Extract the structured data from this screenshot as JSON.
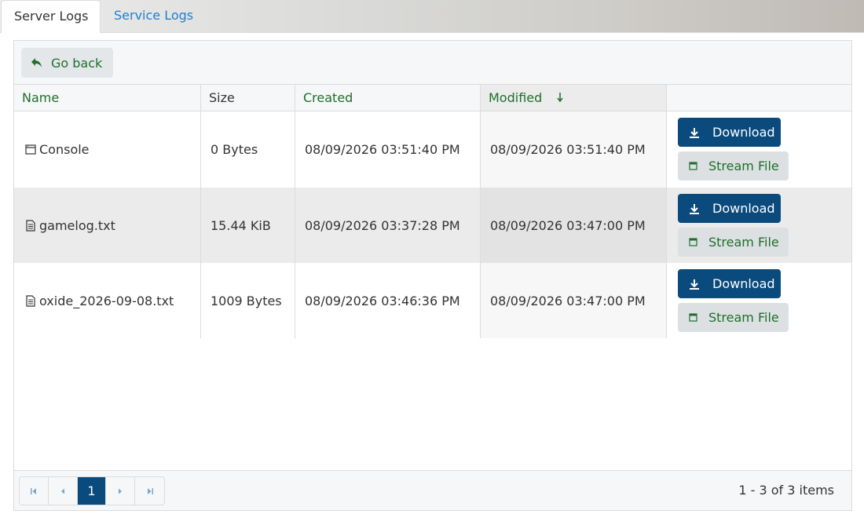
{
  "tabs": [
    {
      "label": "Server Logs",
      "active": true
    },
    {
      "label": "Service Logs",
      "active": false
    }
  ],
  "toolbar": {
    "back_label": "Go back",
    "back_icon": "reply-arrow-icon"
  },
  "columns": [
    {
      "label": "Name"
    },
    {
      "label": "Size"
    },
    {
      "label": "Created"
    },
    {
      "label": "Modified",
      "sort": "descending"
    },
    {
      "label": ""
    }
  ],
  "rows": [
    {
      "icon": "console-window-icon",
      "name": "Console",
      "size": "0 Bytes",
      "created": "08/09/2026 03:51:40 PM",
      "modified": "08/09/2026 03:51:40 PM"
    },
    {
      "icon": "text-file-icon",
      "name": "gamelog.txt",
      "size": "15.44 KiB",
      "created": "08/09/2026 03:37:28 PM",
      "modified": "08/09/2026 03:47:00 PM"
    },
    {
      "icon": "text-file-icon",
      "name": "oxide_2026-09-08.txt",
      "size": "1009 Bytes",
      "created": "08/09/2026 03:46:36 PM",
      "modified": "08/09/2026 03:47:00 PM"
    }
  ],
  "actions": {
    "download_label": "Download",
    "stream_label": "Stream File"
  },
  "pager": {
    "current_page": "1",
    "items_info": "1 - 3 of 3 items"
  },
  "colors": {
    "primary": "#0b4a7c",
    "accent_green": "#1e6f2a",
    "tab_link": "#1f7fd0"
  }
}
